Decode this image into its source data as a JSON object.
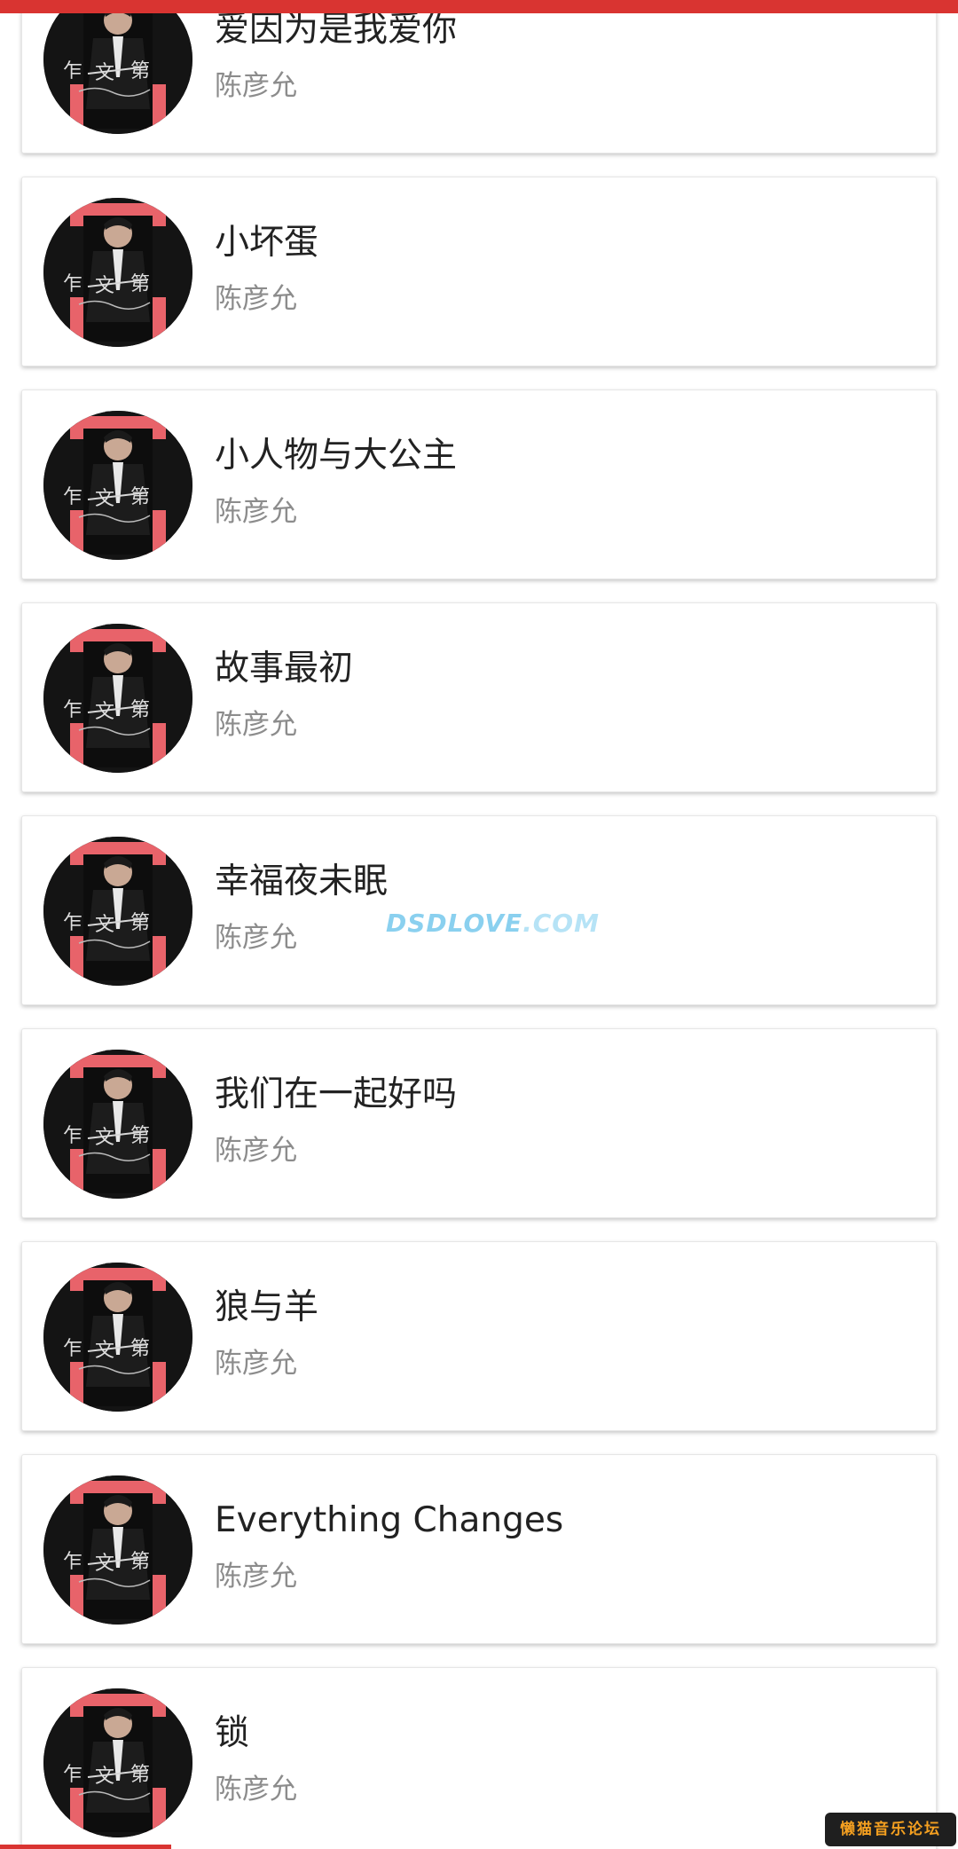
{
  "songs": [
    {
      "title": "爱因为是我爱你",
      "artist": "陈彦允"
    },
    {
      "title": "小坏蛋",
      "artist": "陈彦允"
    },
    {
      "title": "小人物与大公主",
      "artist": "陈彦允"
    },
    {
      "title": "故事最初",
      "artist": "陈彦允"
    },
    {
      "title": "幸福夜未眠",
      "artist": "陈彦允"
    },
    {
      "title": "我们在一起好吗",
      "artist": "陈彦允"
    },
    {
      "title": "狼与羊",
      "artist": "陈彦允"
    },
    {
      "title": "Everything Changes",
      "artist": "陈彦允"
    },
    {
      "title": "锁",
      "artist": "陈彦允"
    }
  ],
  "watermark": {
    "main": "DSDLOVE",
    "suffix": ".COM"
  },
  "forum_badge": "懒猫音乐论坛",
  "colors": {
    "accent": "#d93431",
    "cover_red": "#e8636a",
    "watermark": "#8ad0ef"
  }
}
